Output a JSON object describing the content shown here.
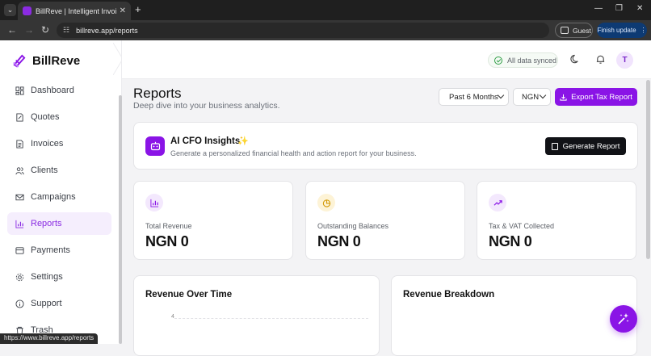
{
  "browser": {
    "tab_title": "BillReve | Intelligent Invoicing & ...",
    "url": "billreve.app/reports",
    "guest_label": "Guest",
    "finish_update_label": "Finish update",
    "status_url": "https://www.billreve.app/reports"
  },
  "app": {
    "brand": "BillReve",
    "brand_color": "#8a14e6"
  },
  "sidebar": {
    "items": [
      {
        "label": "Dashboard",
        "icon": "dashboard-icon",
        "active": false
      },
      {
        "label": "Quotes",
        "icon": "quote-icon",
        "active": false
      },
      {
        "label": "Invoices",
        "icon": "invoice-icon",
        "active": false
      },
      {
        "label": "Clients",
        "icon": "users-icon",
        "active": false
      },
      {
        "label": "Campaigns",
        "icon": "mail-icon",
        "active": false
      },
      {
        "label": "Reports",
        "icon": "bar-chart-icon",
        "active": true
      },
      {
        "label": "Payments",
        "icon": "wallet-icon",
        "active": false
      },
      {
        "label": "Settings",
        "icon": "gear-icon",
        "active": false
      },
      {
        "label": "Support",
        "icon": "info-icon",
        "active": false
      },
      {
        "label": "Trash",
        "icon": "trash-icon",
        "active": false
      }
    ]
  },
  "header": {
    "sync_status": "All data synced",
    "avatar_initial": "T"
  },
  "page": {
    "title": "Reports",
    "subtitle": "Deep dive into your business analytics.",
    "period_select": "Past 6 Months",
    "currency_select": "NGN",
    "export_label": "Export Tax Report"
  },
  "ai_cfo": {
    "title": "AI CFO Insights",
    "description": "Generate a personalized financial health and action report for your business.",
    "button_label": "Generate Report"
  },
  "stats": [
    {
      "label": "Total Revenue",
      "value": "NGN 0",
      "icon": "bar-chart-icon",
      "icon_bg": "#f3e8fd",
      "icon_color": "#8a14e6"
    },
    {
      "label": "Outstanding Balances",
      "value": "NGN 0",
      "icon": "pie-chart-icon",
      "icon_bg": "#fdf3d6",
      "icon_color": "#d39a06"
    },
    {
      "label": "Tax & VAT Collected",
      "value": "NGN 0",
      "icon": "trend-up-icon",
      "icon_bg": "#f3e8fd",
      "icon_color": "#8a14e6"
    }
  ],
  "charts": {
    "revenue_over_time": {
      "title": "Revenue Over Time",
      "y_tick": "4"
    },
    "revenue_breakdown": {
      "title": "Revenue Breakdown"
    }
  }
}
